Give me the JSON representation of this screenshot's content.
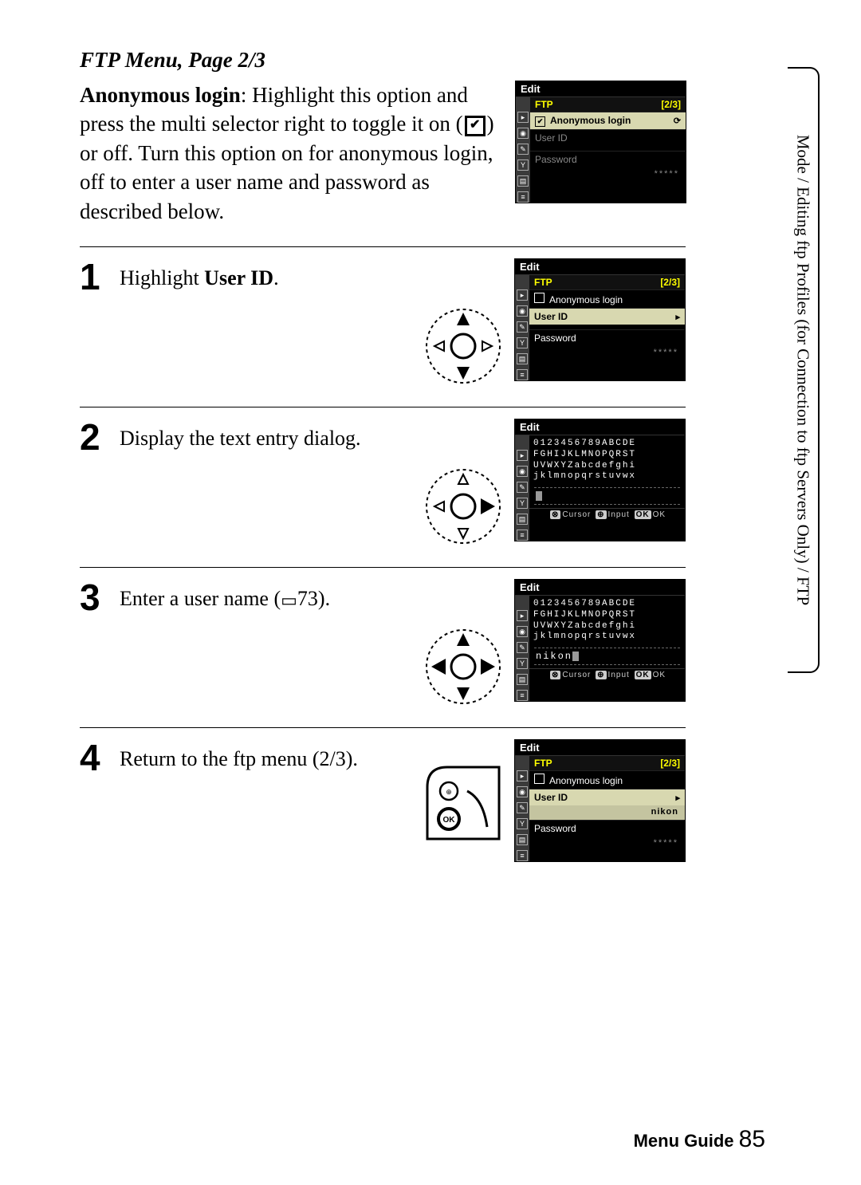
{
  "section_title": "FTP Menu, Page 2/3",
  "intro": {
    "heading": "Anonymous login",
    "text_before_icon": ": Highlight this option and press the multi selector right to toggle it on (",
    "text_after_icon": ") or off.  Turn this option on for anonymous login, off to enter a user name and password as described below."
  },
  "side_tab": "Mode / Editing ftp Profiles (for Connection to ftp Servers Only) / FTP",
  "steps": [
    {
      "num": "1",
      "text_before_bold": "Highlight ",
      "bold": "User ID",
      "text_after_bold": "."
    },
    {
      "num": "2",
      "text": "Display the text entry dialog."
    },
    {
      "num": "3",
      "text_before_ref": "Enter a user name (",
      "ref": "73",
      "text_after_ref": ")."
    },
    {
      "num": "4",
      "text": "Return to the ftp menu (2/3)."
    }
  ],
  "lcd_common": {
    "edit": "Edit",
    "ftp": "FTP",
    "page": "[2/3]",
    "anon": "Anonymous login",
    "user": "User ID",
    "pass": "Password",
    "mask": "*****",
    "foot_cursor": "Cursor",
    "foot_input": "Input",
    "foot_ok": "OK",
    "entry_value": "nikon",
    "char_rows": [
      "0123456789ABCDE",
      "FGHIJKLMNOPQRST",
      "UVWXYZabcdefghi",
      "jklmnopqrstuvwx"
    ]
  },
  "footer": {
    "label": "Menu Guide",
    "page": "85"
  }
}
